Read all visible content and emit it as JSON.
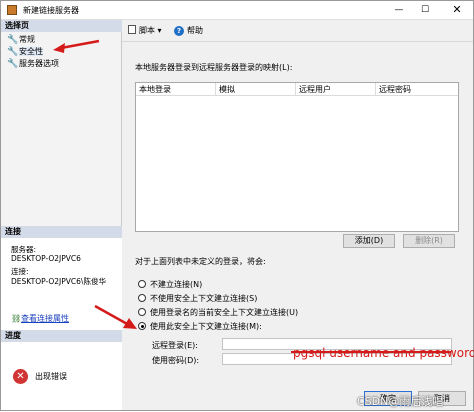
{
  "window": {
    "title": "新建链接服务器"
  },
  "left": {
    "select_page_header": "选择页",
    "pages": [
      {
        "label": "常规"
      },
      {
        "label": "安全性"
      },
      {
        "label": "服务器选项"
      }
    ],
    "connection_header": "连接",
    "server_label": "服务器:",
    "server_value": "DESKTOP-O2JPVC6",
    "connection_label": "连接:",
    "connection_value": "DESKTOP-O2JPVC6\\陈俊华",
    "view_properties_link": "查看连接属性",
    "progress_header": "进度",
    "progress_status": "出现错误"
  },
  "toolbar": {
    "script_label": "脚本",
    "help_label": "帮助"
  },
  "main": {
    "mapping_label": "本地服务器登录到远程服务器登录的映射(L):",
    "table_columns": [
      "本地登录",
      "模拟",
      "远程用户",
      "远程密码"
    ],
    "add_button": "添加(D)",
    "delete_button": "删除(R)",
    "undefined_label": "对于上面列表中未定义的登录，将会:",
    "options": [
      {
        "label": "不建立连接(N)"
      },
      {
        "label": "不使用安全上下文建立连接(S)"
      },
      {
        "label": "使用登录名的当前安全上下文建立连接(U)"
      },
      {
        "label": "使用此安全上下文建立连接(M):"
      }
    ],
    "selected_option_index": 3,
    "remote_login_label": "远程登录(E):",
    "password_label": "使用密码(D):",
    "remote_login_value": "",
    "password_value": "",
    "ok_button": "确定",
    "cancel_button": "取消"
  },
  "annotations": {
    "overlay_text": "pgsql username and password",
    "arrow_color": "#d51a1a"
  },
  "watermark": "CSDN@雨后浅唱"
}
